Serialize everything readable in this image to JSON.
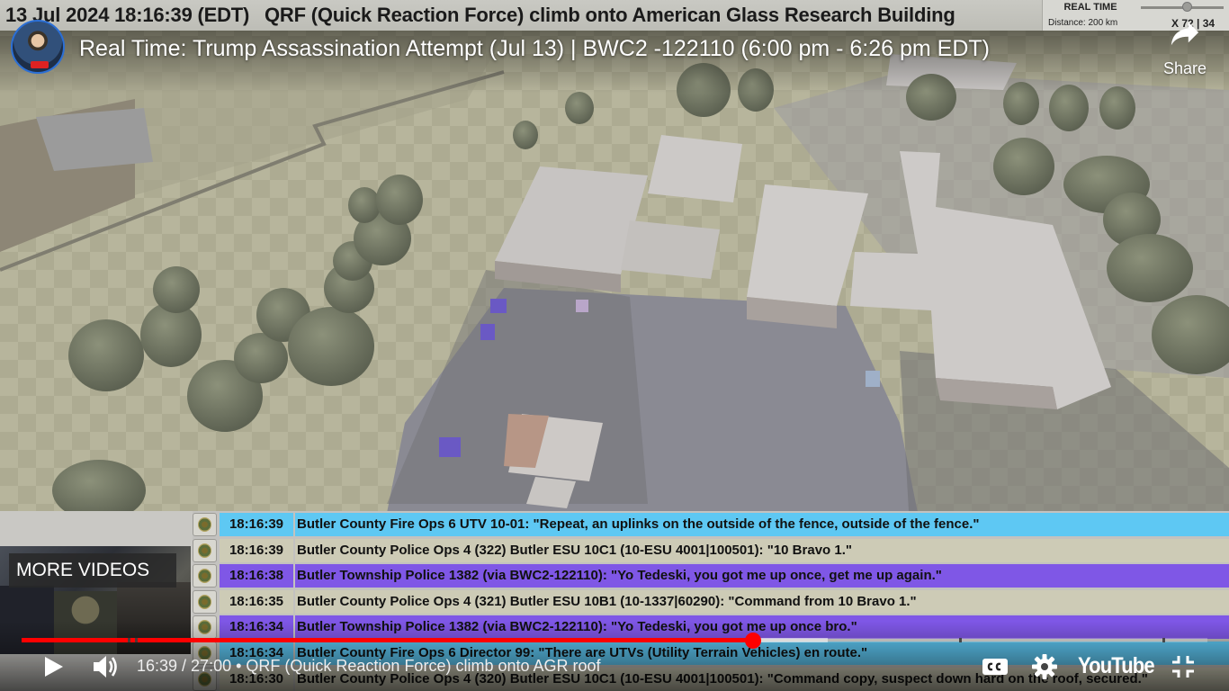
{
  "caption_bar": {
    "datetime": "13 Jul 2024 18:16:39 (EDT)",
    "event": "QRF (Quick Reaction Force) climb onto American Glass Research Building",
    "real_time_title": "REAL TIME",
    "distance": "Distance: 200 km",
    "speed": "X 72 | 34"
  },
  "player": {
    "video_title": "Real Time: Trump Assassination Attempt (Jul 13) | BWC2 -122110 (6:00 pm - 6:26 pm EDT)",
    "share_label": "Share",
    "more_videos_label": "MORE VIDEOS",
    "time_display": "16:39 / 27:00 • QRF (Quick Reaction Force) climb onto AGR roof",
    "progress_fraction": 0.6167,
    "buffer_fraction": 0.68,
    "logo_text": "YouTube",
    "icons": {
      "share": "share-arrow-icon",
      "play": "play-icon",
      "volume": "volume-icon",
      "captions": "closed-captions-icon",
      "settings": "gear-icon",
      "exit_fullscreen": "exit-fullscreen-icon"
    },
    "colors": {
      "progress": "#ff0000",
      "accent_blue": "#5ec8f3",
      "accent_purple": "#7f57e6",
      "accent_tan": "#cdcbb6"
    }
  },
  "log": {
    "rows": [
      {
        "time": "18:16:39",
        "style": "blue",
        "message": "Butler County Fire Ops 6 UTV 10-01: \"Repeat, an uplinks on the outside of the fence, outside of the fence.\""
      },
      {
        "time": "18:16:39",
        "style": "tan",
        "message": "Butler County Police Ops 4 (322) Butler ESU 10C1 (10-ESU 4001|100501): \"10 Bravo 1.\""
      },
      {
        "time": "18:16:38",
        "style": "purple",
        "message": "Butler Township Police 1382 (via BWC2-122110): \"Yo Tedeski, you got me up once, get me up again.\""
      },
      {
        "time": "18:16:35",
        "style": "tan",
        "message": "Butler County Police Ops 4 (321) Butler ESU 10B1 (10-1337|60290): \"Command from 10 Bravo 1.\""
      },
      {
        "time": "18:16:34",
        "style": "purple",
        "message": "Butler Township Police 1382 (via BWC2-122110): \"Yo Tedeski, you got me up once bro.\""
      },
      {
        "time": "18:16:34",
        "style": "blue",
        "message": "Butler County Fire Ops 6 Director 99: \"There are UTVs (Utility Terrain Vehicles) en route.\""
      },
      {
        "time": "18:16:30",
        "style": "tan",
        "message": "Butler County Police Ops 4 (320) Butler ESU 10C1 (10-ESU 4001|100501): \"Command copy, suspect down hard on the roof, secured.\""
      }
    ]
  }
}
